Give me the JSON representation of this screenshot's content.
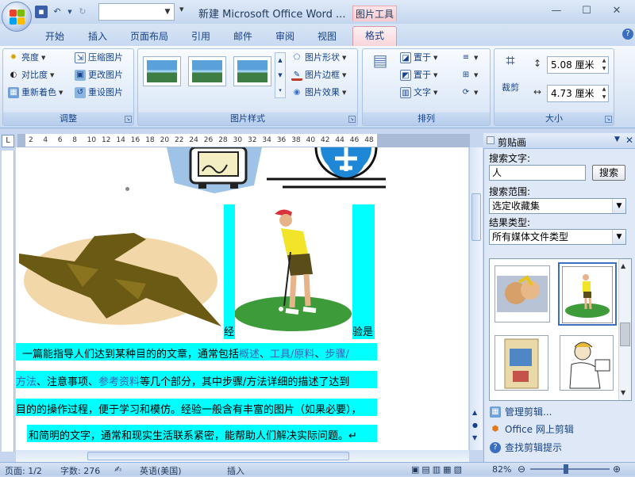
{
  "titlebar": {
    "doc_title": "新建 Microsoft Office Word ...",
    "context_tab_label": "图片工具",
    "win_min": "—",
    "win_max": "☐",
    "win_close": "✕"
  },
  "tabs": [
    "开始",
    "插入",
    "页面布局",
    "引用",
    "邮件",
    "审阅",
    "视图",
    "格式"
  ],
  "groups": {
    "adjust": {
      "label": "调整",
      "brightness": "亮度",
      "contrast": "对比度",
      "recolor": "重新着色",
      "compress": "压缩图片",
      "change": "更改图片",
      "reset": "重设图片"
    },
    "styles": {
      "label": "图片样式",
      "shape": "图片形状",
      "border": "图片边框",
      "effects": "图片效果"
    },
    "arrange": {
      "label": "排列",
      "bring_front": "置于",
      "send_back": "置于",
      "wrap": "文字"
    },
    "size": {
      "label": "大小",
      "crop": "裁剪",
      "height": "5.08 厘米",
      "width": "4.73 厘米"
    }
  },
  "ruler_marks": [
    "2",
    "4",
    "6",
    "8",
    "10",
    "12",
    "14",
    "16",
    "18",
    "20",
    "22",
    "24",
    "26",
    "28",
    "30",
    "32",
    "34",
    "36",
    "38",
    "40",
    "42",
    "44",
    "46",
    "48"
  ],
  "ruler_corner": "L",
  "document": {
    "line0_left": "经",
    "line0_right": "验是",
    "line1_a": "一篇能指导人们达到某种目的的文章，通常包括",
    "line1_l1": "概述",
    "line1_sep1": "、",
    "line1_l2": "工具/原料",
    "line1_sep2": "、",
    "line1_l3": "步骤/",
    "line2_l1": "方法",
    "line2_a": "、注意事项、",
    "line2_l2": "参考资料",
    "line2_b": "等几个部分，其中步骤/方法详细的描述了达到",
    "line3": "目的的操作过程，便于学习和模仿。经验一般含有丰富的图片（如果必要），",
    "line4": "和简明的文字，通常和现实生活联系紧密，能帮助人们解决实际问题。↵"
  },
  "pane": {
    "title": "剪贴画",
    "search_label": "搜索文字:",
    "search_value": "人",
    "search_button": "搜索",
    "scope_label": "搜索范围:",
    "scope_value": "选定收藏集",
    "type_label": "结果类型:",
    "type_value": "所有媒体文件类型",
    "link_organize": "管理剪辑...",
    "link_online": "Office 网上剪辑",
    "link_tips": "查找剪辑提示"
  },
  "status": {
    "page": "页面: 1/2",
    "words": "字数: 276",
    "language": "英语(美国)",
    "mode": "插入",
    "zoom": "82%"
  },
  "colors": {
    "highlight": "#00ffff",
    "link": "#3a66b7",
    "ribbon_text": "#15428b",
    "context_tab": "#f7d5db"
  }
}
